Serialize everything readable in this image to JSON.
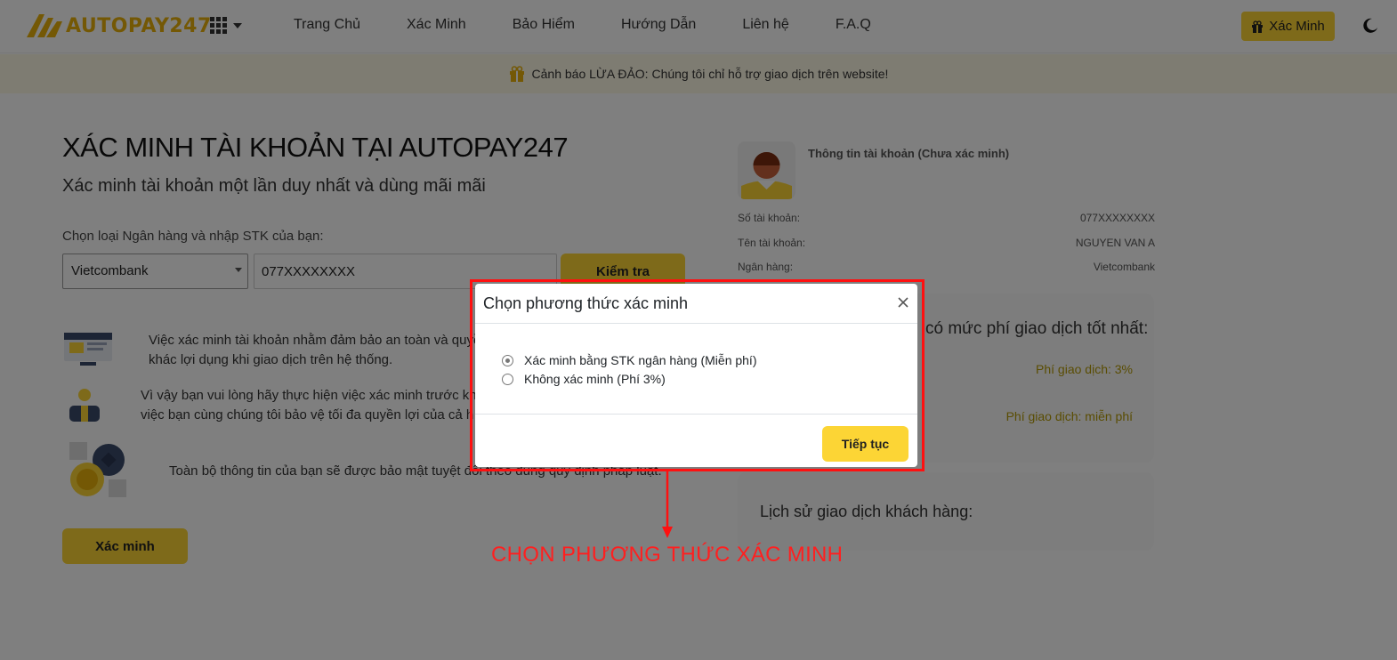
{
  "brand": {
    "name": "AUTOPAY247",
    "accent": "#fcd535",
    "logo_color": "#e8b10b"
  },
  "nav": {
    "items": [
      "Trang Chủ",
      "Xác Minh",
      "Bảo Hiểm",
      "Hướng Dẫn",
      "Liên hệ",
      "F.A.Q"
    ]
  },
  "header": {
    "verify_button": "Xác Minh"
  },
  "banner": {
    "text": "Cảnh báo LỪA ĐẢO: Chúng tôi chỉ hỗ trợ giao dịch trên website!"
  },
  "main": {
    "title": "XÁC MINH TÀI KHOẢN TẠI AUTOPAY247",
    "subtitle": "Xác minh tài khoản một lần duy nhất và dùng mãi mãi",
    "choose_label": "Chọn loại Ngân hàng và nhập STK của bạn:",
    "bank_selected": "Vietcombank",
    "account_value": "077XXXXXXXX",
    "check_button": "Kiểm tra",
    "info": [
      {
        "line1": "Việc xác minh tài khoản nhằm đảm bảo an toàn và quyề",
        "line2": "khác lợi dụng khi giao dịch trên hệ thống."
      },
      {
        "line1": "Vì vậy bạn vui lòng hãy thực hiện việc xác minh trước khi",
        "line2": "việc bạn cùng chúng tôi bảo vệ tối đa quyền lợi của cả h"
      },
      {
        "line1": "Toàn bộ thông tin của bạn sẽ được bảo mật tuyệt đối theo đúng quy định pháp luật."
      }
    ],
    "verify_button": "Xác minh"
  },
  "account_panel": {
    "status": "Thông tin tài khoản (Chưa xác minh)",
    "fields": [
      {
        "label": "Số tài khoản:",
        "value": "077XXXXXXXX"
      },
      {
        "label": "Tên tài khoản:",
        "value": "NGUYEN VAN A"
      },
      {
        "label": "Ngân hàng:",
        "value": "Vietcombank"
      }
    ],
    "fee_title": "có mức phí giao dịch tốt nhất:",
    "fee1": "Phí giao dịch: 3%",
    "fee2": "Phí giao dịch: miễn phí",
    "history_title": "Lịch sử giao dịch khách hàng:"
  },
  "modal": {
    "title": "Chọn phương thức xác minh",
    "options": [
      {
        "label": "Xác minh bằng STK ngân hàng (Miễn phí)",
        "checked": true
      },
      {
        "label": "Không xác minh (Phí 3%)",
        "checked": false
      }
    ],
    "continue_button": "Tiếp tục"
  },
  "annotation": {
    "text": "CHỌN PHƯƠNG THỨC XÁC MINH",
    "color": "#ff1f1f"
  }
}
